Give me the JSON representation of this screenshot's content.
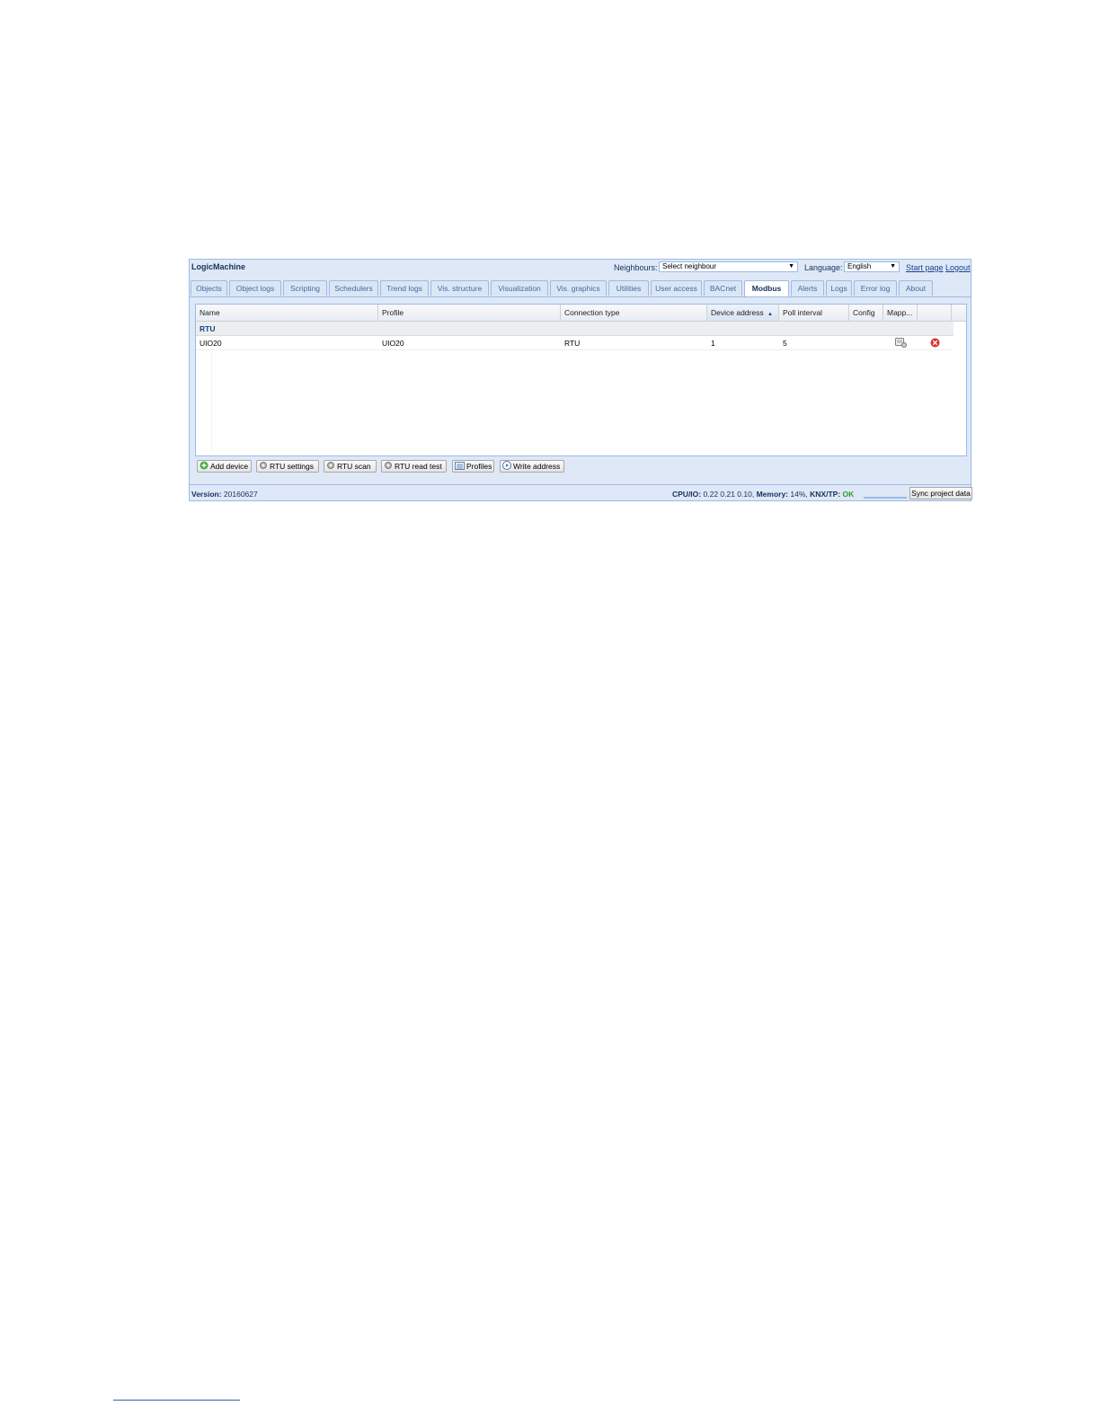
{
  "app": {
    "brand": "LogicMachine"
  },
  "topbar": {
    "neighbours_label": "Neighbours:",
    "neighbours_value": "Select neighbour",
    "language_label": "Language:",
    "language_value": "English",
    "start_page": "Start page",
    "logout": "Logout"
  },
  "tabs": [
    "Objects",
    "Object logs",
    "Scripting",
    "Schedulers",
    "Trend logs",
    "Vis. structure",
    "Visualization",
    "Vis. graphics",
    "Utilities",
    "User access",
    "BACnet",
    "Modbus",
    "Alerts",
    "Logs",
    "Error log",
    "About"
  ],
  "active_tab": "Modbus",
  "grid": {
    "columns": [
      "Name",
      "Profile",
      "Connection type",
      "Device address",
      "Poll interval",
      "Config",
      "Mapp..."
    ],
    "sorted_column": "Device address",
    "group": "RTU",
    "rows": [
      {
        "name": "UIO20",
        "profile": "UIO20",
        "connection_type": "RTU",
        "device_address": "1",
        "poll_interval": "5"
      }
    ]
  },
  "toolbar": {
    "add_device": "Add device",
    "rtu_settings": "RTU settings",
    "rtu_scan": "RTU scan",
    "rtu_read_test": "RTU read test",
    "profiles": "Profiles",
    "write_address": "Write address"
  },
  "status": {
    "version_label": "Version:",
    "version_value": "20160627",
    "cpu_label": "CPU/IO:",
    "cpu_value": "0.22 0.21 0.10,",
    "memory_label": "Memory:",
    "memory_value": "14%,",
    "knx_label": "KNX/TP:",
    "knx_value": "OK",
    "sync_button": "Sync project data"
  },
  "colors": {
    "panel": "#dfe8f6",
    "border": "#99bbe8",
    "ok": "#2e9e2e",
    "delete": "#d9312b"
  }
}
